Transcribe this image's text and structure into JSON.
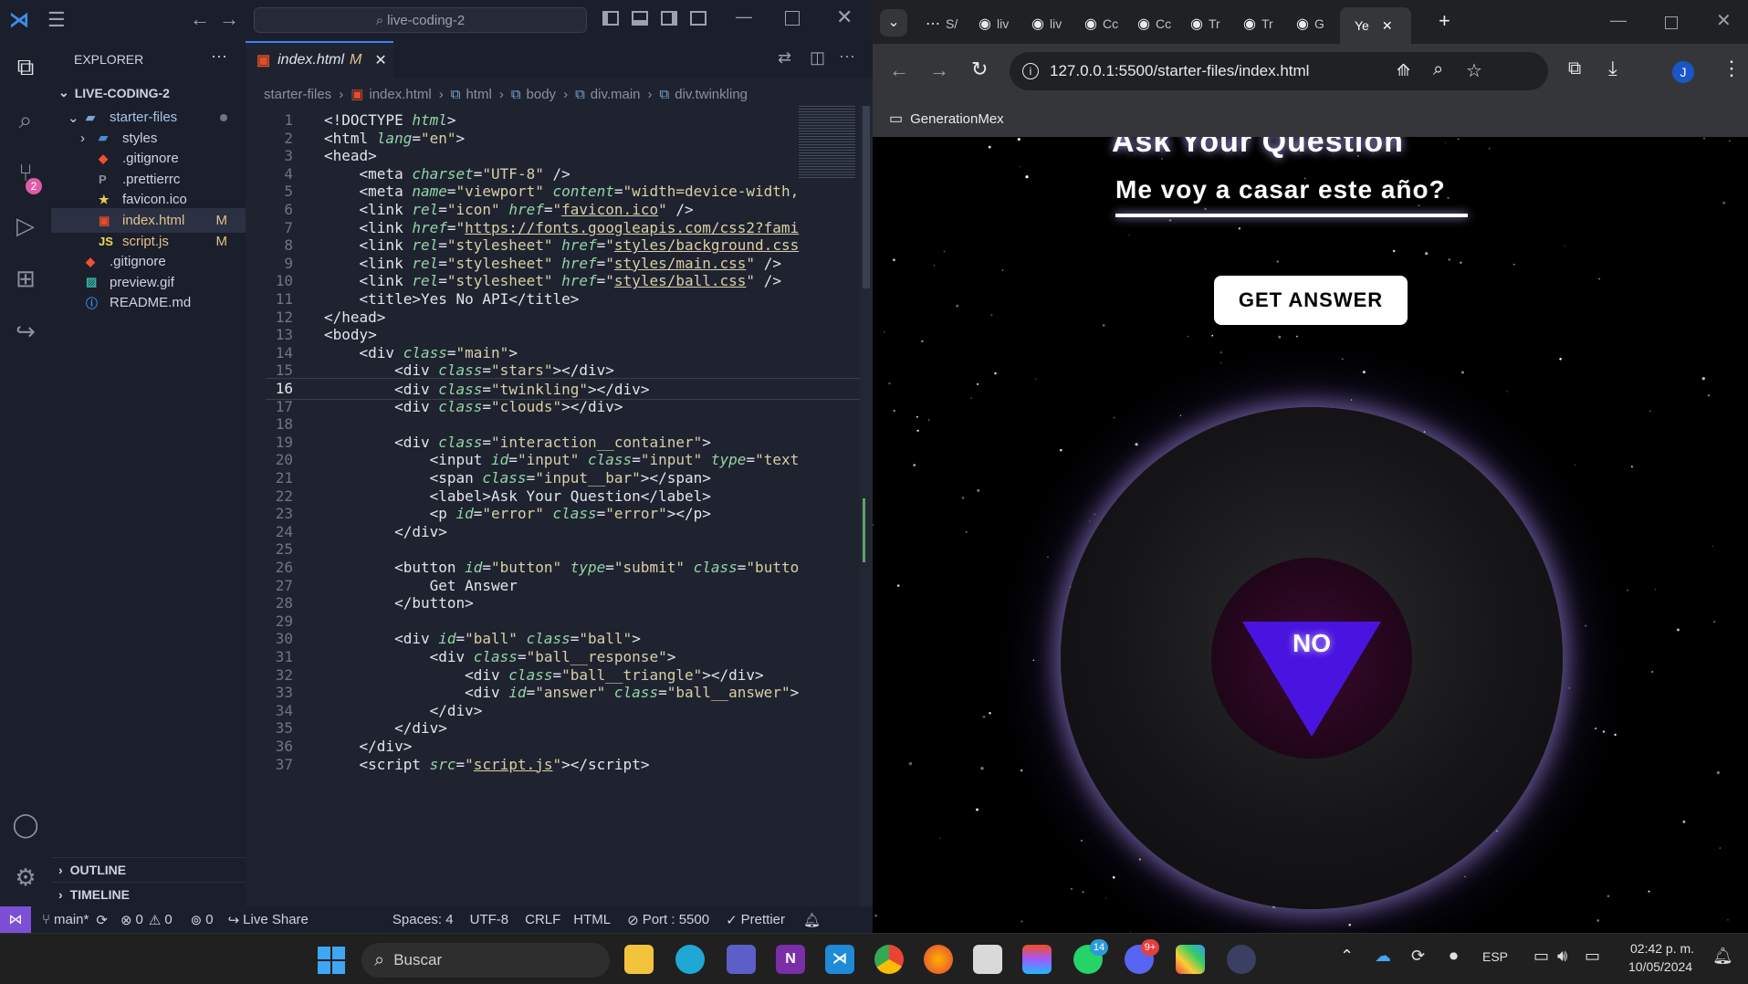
{
  "vscode": {
    "command_center": "live-coding-2",
    "explorer_title": "EXPLORER",
    "workspace": "LIVE-CODING-2",
    "tree": [
      {
        "label": "starter-files",
        "badge": "",
        "depth": 1,
        "icon": "folder-open-icon"
      },
      {
        "label": "styles",
        "badge": "",
        "depth": 2,
        "icon": "folder-icon"
      },
      {
        "label": ".gitignore",
        "badge": "",
        "depth": 2,
        "icon": "git-icon"
      },
      {
        "label": ".prettierrc",
        "badge": "",
        "depth": 2,
        "icon": "prettier-icon"
      },
      {
        "label": "favicon.ico",
        "badge": "",
        "depth": 2,
        "icon": "star-icon"
      },
      {
        "label": "index.html",
        "badge": "M",
        "depth": 2,
        "icon": "html-icon"
      },
      {
        "label": "script.js",
        "badge": "M",
        "depth": 2,
        "icon": "js-icon"
      },
      {
        "label": ".gitignore",
        "badge": "",
        "depth": 1,
        "icon": "git-icon"
      },
      {
        "label": "preview.gif",
        "badge": "",
        "depth": 1,
        "icon": "image-icon"
      },
      {
        "label": "README.md",
        "badge": "",
        "depth": 1,
        "icon": "info-icon"
      }
    ],
    "outline": "OUTLINE",
    "timeline": "TIMELINE",
    "scm_badge": "2",
    "tab": {
      "name": "index.html",
      "flag": "M"
    },
    "breadcrumbs": [
      "starter-files",
      "index.html",
      "html",
      "body",
      "div.main",
      "div.twinkling"
    ],
    "lines": [
      {
        "n": "1",
        "html": "<span class='t'>&lt;!DOCTYPE </span><span class='a'>html</span><span class='t'>&gt;</span>"
      },
      {
        "n": "2",
        "html": "<span class='t'>&lt;html </span><span class='a'>lang</span><span class='t'>=</span><span class='s'>\"en\"</span><span class='t'>&gt;</span>"
      },
      {
        "n": "3",
        "html": "<span class='t'>&lt;head&gt;</span>"
      },
      {
        "n": "4",
        "html": "    <span class='t'>&lt;meta </span><span class='a'>charset</span><span class='t'>=</span><span class='s'>\"UTF-8\"</span><span class='t'> /&gt;</span>"
      },
      {
        "n": "5",
        "html": "    <span class='t'>&lt;meta </span><span class='a'>name</span><span class='t'>=</span><span class='s'>\"viewport\"</span><span class='t'> </span><span class='a'>content</span><span class='t'>=</span><span class='s'>\"width=device-width,</span>"
      },
      {
        "n": "6",
        "html": "    <span class='t'>&lt;link </span><span class='a'>rel</span><span class='t'>=</span><span class='s'>\"icon\"</span><span class='t'> </span><span class='a'>href</span><span class='t'>=</span><span class='s'>\"<u>favicon.ico</u>\"</span><span class='t'> /&gt;</span>"
      },
      {
        "n": "7",
        "html": "    <span class='t'>&lt;link </span><span class='a'>href</span><span class='t'>=</span><span class='s'>\"<u>https://fonts.googleapis.com/css2?fami</u></span>"
      },
      {
        "n": "8",
        "html": "    <span class='t'>&lt;link </span><span class='a'>rel</span><span class='t'>=</span><span class='s'>\"stylesheet\"</span><span class='t'> </span><span class='a'>href</span><span class='t'>=</span><span class='s'>\"<u>styles/background.css</u></span>"
      },
      {
        "n": "9",
        "html": "    <span class='t'>&lt;link </span><span class='a'>rel</span><span class='t'>=</span><span class='s'>\"stylesheet\"</span><span class='t'> </span><span class='a'>href</span><span class='t'>=</span><span class='s'>\"<u>styles/main.css</u>\"</span><span class='t'> /&gt;</span>"
      },
      {
        "n": "10",
        "html": "    <span class='t'>&lt;link </span><span class='a'>rel</span><span class='t'>=</span><span class='s'>\"stylesheet\"</span><span class='t'> </span><span class='a'>href</span><span class='t'>=</span><span class='s'>\"<u>styles/ball.css</u>\"</span><span class='t'> /&gt;</span>"
      },
      {
        "n": "11",
        "html": "    <span class='t'>&lt;title&gt;Yes No API&lt;/title&gt;</span>"
      },
      {
        "n": "12",
        "html": "<span class='t'>&lt;/head&gt;</span>"
      },
      {
        "n": "13",
        "html": "<span class='t'>&lt;body&gt;</span>"
      },
      {
        "n": "14",
        "html": "    <span class='t'>&lt;div </span><span class='a'>class</span><span class='t'>=</span><span class='s'>\"main\"</span><span class='t'>&gt;</span>"
      },
      {
        "n": "15",
        "html": "        <span class='t'>&lt;div </span><span class='a'>class</span><span class='t'>=</span><span class='s'>\"stars\"</span><span class='t'>&gt;&lt;/div&gt;</span>"
      },
      {
        "n": "16",
        "html": "        <span class='t'>&lt;div </span><span class='a'>class</span><span class='t'>=</span><span class='s'>\"twinkling\"</span><span class='t'>&gt;&lt;/div&gt;</span>"
      },
      {
        "n": "17",
        "html": "        <span class='t'>&lt;div </span><span class='a'>class</span><span class='t'>=</span><span class='s'>\"clouds\"</span><span class='t'>&gt;&lt;/div&gt;</span>"
      },
      {
        "n": "18",
        "html": ""
      },
      {
        "n": "19",
        "html": "        <span class='t'>&lt;div </span><span class='a'>class</span><span class='t'>=</span><span class='s'>\"interaction__container\"</span><span class='t'>&gt;</span>"
      },
      {
        "n": "20",
        "html": "            <span class='t'>&lt;input </span><span class='a'>id</span><span class='t'>=</span><span class='s'>\"input\"</span><span class='t'> </span><span class='a'>class</span><span class='t'>=</span><span class='s'>\"input\"</span><span class='t'> </span><span class='a'>type</span><span class='t'>=</span><span class='s'>\"text</span>"
      },
      {
        "n": "21",
        "html": "            <span class='t'>&lt;span </span><span class='a'>class</span><span class='t'>=</span><span class='s'>\"input__bar\"</span><span class='t'>&gt;&lt;/span&gt;</span>"
      },
      {
        "n": "22",
        "html": "            <span class='t'>&lt;label&gt;Ask Your Question&lt;/label&gt;</span>"
      },
      {
        "n": "23",
        "html": "            <span class='t'>&lt;p </span><span class='a'>id</span><span class='t'>=</span><span class='s'>\"error\"</span><span class='t'> </span><span class='a'>class</span><span class='t'>=</span><span class='s'>\"error\"</span><span class='t'>&gt;&lt;/p&gt;</span>"
      },
      {
        "n": "24",
        "html": "        <span class='t'>&lt;/div&gt;</span>"
      },
      {
        "n": "25",
        "html": ""
      },
      {
        "n": "26",
        "html": "        <span class='t'>&lt;button </span><span class='a'>id</span><span class='t'>=</span><span class='s'>\"button\"</span><span class='t'> </span><span class='a'>type</span><span class='t'>=</span><span class='s'>\"submit\"</span><span class='t'> </span><span class='a'>class</span><span class='t'>=</span><span class='s'>\"butto</span>"
      },
      {
        "n": "27",
        "html": "            <span class='t'>Get Answer</span>"
      },
      {
        "n": "28",
        "html": "        <span class='t'>&lt;/button&gt;</span>"
      },
      {
        "n": "29",
        "html": ""
      },
      {
        "n": "30",
        "html": "        <span class='t'>&lt;div </span><span class='a'>id</span><span class='t'>=</span><span class='s'>\"ball\"</span><span class='t'> </span><span class='a'>class</span><span class='t'>=</span><span class='s'>\"ball\"</span><span class='t'>&gt;</span>"
      },
      {
        "n": "31",
        "html": "            <span class='t'>&lt;div </span><span class='a'>class</span><span class='t'>=</span><span class='s'>\"ball__response\"</span><span class='t'>&gt;</span>"
      },
      {
        "n": "32",
        "html": "                <span class='t'>&lt;div </span><span class='a'>class</span><span class='t'>=</span><span class='s'>\"ball__triangle\"</span><span class='t'>&gt;&lt;/div&gt;</span>"
      },
      {
        "n": "33",
        "html": "                <span class='t'>&lt;div </span><span class='a'>id</span><span class='t'>=</span><span class='s'>\"answer\"</span><span class='t'> </span><span class='a'>class</span><span class='t'>=</span><span class='s'>\"ball__answer\"</span><span class='t'>&gt;</span>"
      },
      {
        "n": "34",
        "html": "            <span class='t'>&lt;/div&gt;</span>"
      },
      {
        "n": "35",
        "html": "        <span class='t'>&lt;/div&gt;</span>"
      },
      {
        "n": "36",
        "html": "    <span class='t'>&lt;/div&gt;</span>"
      },
      {
        "n": "37",
        "html": "    <span class='t'>&lt;script </span><span class='a'>src</span><span class='t'>=</span><span class='s'>\"<u>script.js</u>\"</span><span class='t'>&gt;&lt;/script&gt;</span>"
      }
    ],
    "status": {
      "branch": "main*",
      "errors": "0",
      "warnings": "0",
      "ports": "0",
      "live_share": "Live Share",
      "spaces": "Spaces: 4",
      "encoding": "UTF-8",
      "eol": "CRLF",
      "language": "HTML",
      "port": "Port : 5500",
      "prettier": "Prettier"
    }
  },
  "chrome": {
    "tabs": [
      "S/",
      "liv",
      "liv",
      "Cc",
      "Cc",
      "Tr",
      "Tr",
      "G",
      "Ye"
    ],
    "url": "127.0.0.1:5500/starter-files/index.html",
    "bookmark": "GenerationMex",
    "profile_initial": "J",
    "page": {
      "label": "Ask Your Question",
      "question": "Me voy a casar este año?",
      "button": "GET ANSWER",
      "answer": "NO"
    }
  },
  "taskbar": {
    "search": "Buscar",
    "whatsapp_badge": "14",
    "discord_badge": "9+",
    "lang": "ESP",
    "time": "02:42 p. m.",
    "date": "10/05/2024"
  },
  "colors": {
    "accent": "#3b82f6",
    "modified": "#e2c08d",
    "ball_glow": "#a58ee8",
    "triangle": "#4a14e0"
  }
}
